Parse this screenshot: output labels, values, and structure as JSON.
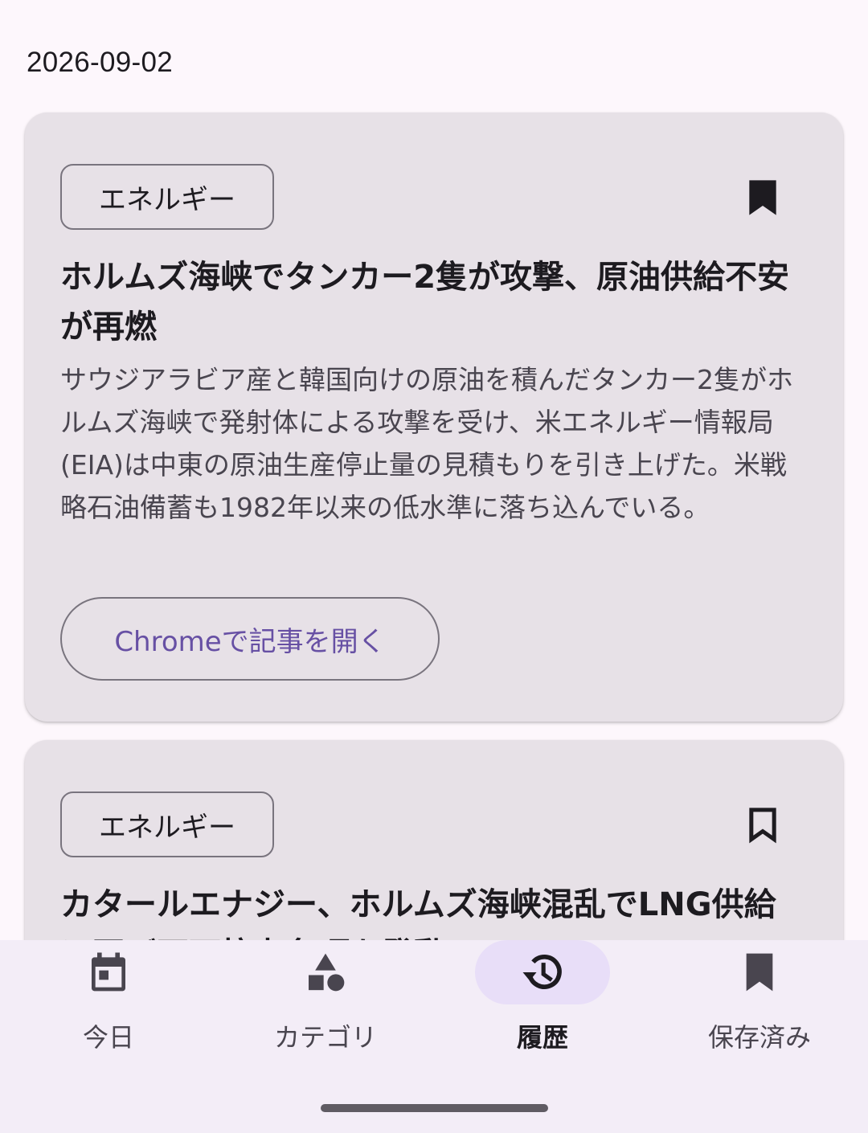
{
  "date": "2026-09-02",
  "articles": [
    {
      "category": "エネルギー",
      "bookmarked": true,
      "bookmark_icon": "bookmark-filled-icon",
      "title": "ホルムズ海峡でタンカー2隻が攻撃、原油供給不安が再燃",
      "summary": "サウジアラビア産と韓国向けの原油を積んだタンカー2隻がホルムズ海峡で発射体による攻撃を受け、米エネルギー情報局(EIA)は中東の原油生産停止量の見積もりを引き上げた。米戦略石油備蓄も1982年以来の低水準に落ち込んでいる。",
      "open_label": "Chromeで記事を開く"
    },
    {
      "category": "エネルギー",
      "bookmarked": false,
      "bookmark_icon": "bookmark-outline-icon",
      "title": "カタールエナジー、ホルムズ海峡混乱でLNG供給に再び不可抗力条項を発動"
    }
  ],
  "nav": {
    "items": [
      {
        "label": "今日",
        "icon": "calendar-icon",
        "active": false
      },
      {
        "label": "カテゴリ",
        "icon": "category-shapes-icon",
        "active": false
      },
      {
        "label": "履歴",
        "icon": "history-icon",
        "active": true
      },
      {
        "label": "保存済み",
        "icon": "bookmark-filled-icon",
        "active": false
      }
    ]
  },
  "colors": {
    "background": "#fdf7fc",
    "card": "#e7e1e7",
    "accent": "#6750a4",
    "nav_background": "#f3edf7",
    "nav_indicator": "#e8def8"
  }
}
